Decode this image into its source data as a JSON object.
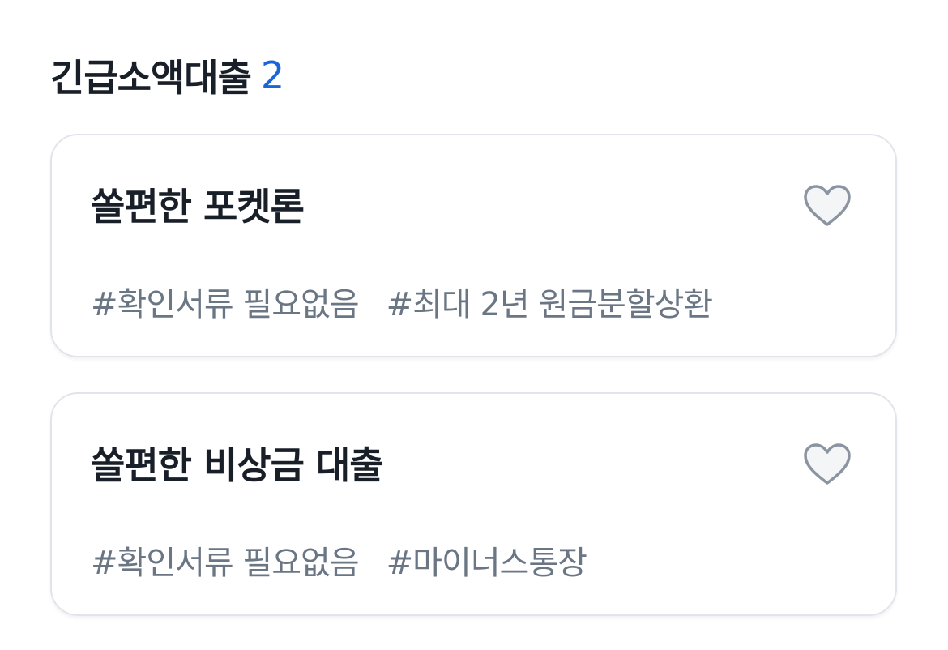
{
  "section": {
    "title": "긴급소액대출",
    "count": "2"
  },
  "products": [
    {
      "title": "쏠편한 포켓론",
      "tags": [
        "#확인서류 필요없음",
        "#최대 2년 원금분할상환"
      ],
      "favorite_icon": "heart-outline-icon"
    },
    {
      "title": "쏠편한 비상금 대출",
      "tags": [
        "#확인서류 필요없음",
        "#마이너스통장"
      ],
      "favorite_icon": "heart-outline-icon"
    }
  ],
  "colors": {
    "accent": "#1b64da",
    "title_text": "#191f28",
    "tag_text": "#6b7684",
    "card_border": "#e1e5eb",
    "heart_stroke": "#8b95a1",
    "heart_fill": "#f4f5f7"
  }
}
